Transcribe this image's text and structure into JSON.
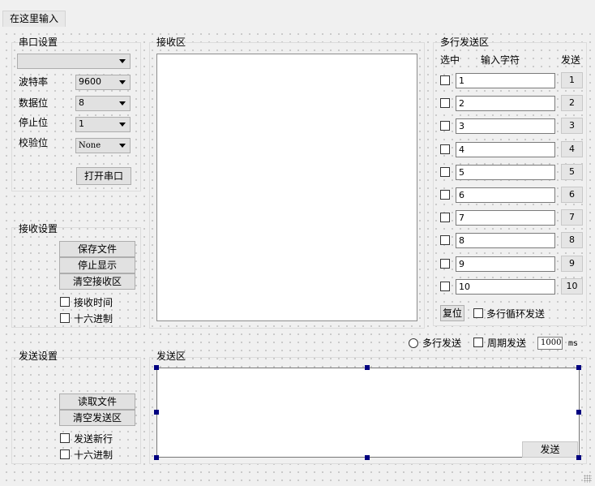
{
  "top_tab": "在这里输入",
  "serial": {
    "title": "串口设置",
    "port_value": "",
    "baud_label": "波特率",
    "baud_value": "9600",
    "data_label": "数据位",
    "data_value": "8",
    "stop_label": "停止位",
    "stop_value": "1",
    "parity_label": "校验位",
    "parity_value": "None",
    "open_button": "打开串口"
  },
  "receive_settings": {
    "title": "接收设置",
    "save_file": "保存文件",
    "stop_display": "停止显示",
    "clear_receive": "清空接收区",
    "receive_time": "接收时间",
    "hex": "十六进制"
  },
  "receive_area": {
    "title": "接收区"
  },
  "multi_send": {
    "title": "多行发送区",
    "col_select": "选中",
    "col_input": "输入字符",
    "col_send": "发送",
    "rows": [
      {
        "value": "1",
        "button": "1"
      },
      {
        "value": "2",
        "button": "2"
      },
      {
        "value": "3",
        "button": "3"
      },
      {
        "value": "4",
        "button": "4"
      },
      {
        "value": "5",
        "button": "5"
      },
      {
        "value": "6",
        "button": "6"
      },
      {
        "value": "7",
        "button": "7"
      },
      {
        "value": "8",
        "button": "8"
      },
      {
        "value": "9",
        "button": "9"
      },
      {
        "value": "10",
        "button": "10"
      }
    ],
    "reset_button": "复位",
    "loop_label": "多行循环发送"
  },
  "send_options": {
    "multi_send_label": "多行发送",
    "periodic_label": "周期发送",
    "period_value": "1000",
    "unit": "ms"
  },
  "send_settings": {
    "title": "发送设置",
    "read_file": "读取文件",
    "clear_send": "清空发送区",
    "send_newline": "发送新行",
    "hex": "十六进制"
  },
  "send_area": {
    "title": "发送区",
    "send_button": "发送"
  },
  "colors": {
    "background": "#f0f0f0",
    "button": "#e1e1e1",
    "handle": "#000080"
  }
}
